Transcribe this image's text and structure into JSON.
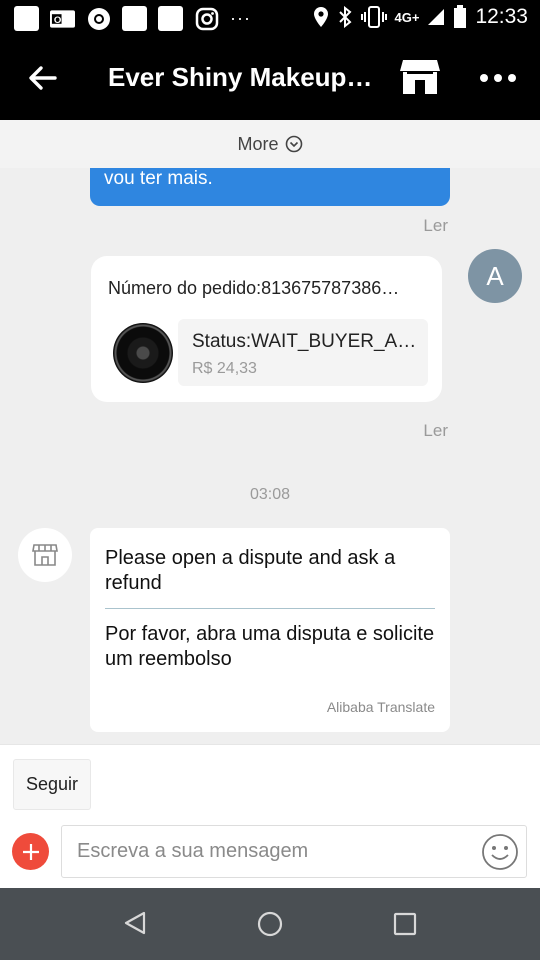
{
  "status_bar": {
    "time": "12:33",
    "network": "4G+"
  },
  "header": {
    "title": "Ever Shiny Makeup…"
  },
  "more_label": "More",
  "messages": {
    "blue_bubble_text": "vou ter mais.",
    "read_label": "Ler",
    "avatar_letter": "A",
    "order_number": "Número do pedido:813675787386…",
    "order_status": "Status:WAIT_BUYER_AC…",
    "order_price": "R$ 24,33",
    "timestamp": "03:08",
    "seller_original": "Please open a dispute and ask a refund",
    "seller_translation": "Por favor, abra uma disputa e solicite um reembolso",
    "translate_credit": "Alibaba Translate"
  },
  "actions": {
    "follow_label": "Seguir"
  },
  "composer": {
    "placeholder": "Escreva a sua mensagem",
    "value": ""
  },
  "colors": {
    "bubble_blue": "#2f86e0",
    "accent_red": "#ef4b3b",
    "avatar_grey": "#7e94a4"
  }
}
